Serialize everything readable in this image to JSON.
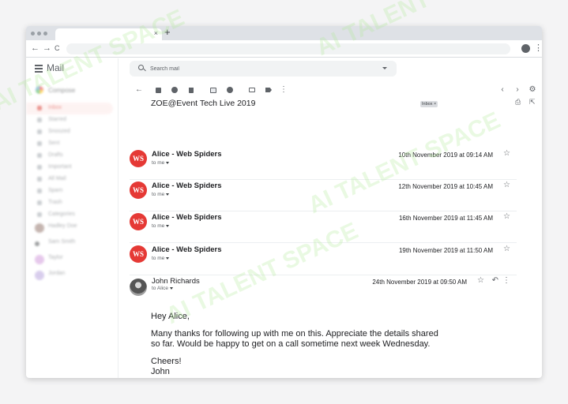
{
  "browser": {
    "tab_close": "×",
    "new_tab": "+",
    "back": "←",
    "forward": "→",
    "reload": "C",
    "menu": "⋮"
  },
  "app": {
    "name": "Mail"
  },
  "sidebar": {
    "compose_label": "Compose",
    "items": [
      "Inbox",
      "Starred",
      "Snoozed",
      "Sent",
      "Drafts",
      "Important",
      "All Mail",
      "Spam",
      "Trash",
      "Categories"
    ],
    "contacts": [
      {
        "name": "Hadley Doe",
        "color": "#8d6e63"
      },
      {
        "name": "Sam Smith",
        "color": "#3c4043"
      },
      {
        "name": "Taylor",
        "color": "#ce93d8"
      },
      {
        "name": "Jordan",
        "color": "#b39ddb"
      }
    ]
  },
  "search": {
    "placeholder": "Search mail"
  },
  "toolbar": {
    "back": "←",
    "more": "⋮",
    "prev": "‹",
    "next": "›",
    "settings": "⚙"
  },
  "thread": {
    "subject": "ZOE@Event Tech Live 2019",
    "label": "Inbox ×",
    "print_icon": "⎙",
    "open_icon": "⇱"
  },
  "messages": [
    {
      "avatar": "WS",
      "sender": "Alice - Web Spiders",
      "to": "to me",
      "date": "10th November 2019 at 09:14 AM"
    },
    {
      "avatar": "WS",
      "sender": "Alice - Web Spiders",
      "to": "to me",
      "date": "12th November 2019 at 10:45 AM"
    },
    {
      "avatar": "WS",
      "sender": "Alice - Web Spiders",
      "to": "to me",
      "date": "16th November 2019 at 11:45 AM"
    },
    {
      "avatar": "WS",
      "sender": "Alice - Web Spiders",
      "to": "to me",
      "date": "19th November 2019 at 11:50 AM"
    }
  ],
  "open_message": {
    "sender": "John Richards",
    "to": "to Alice",
    "date": "24th November 2019 at 09:50 AM",
    "star": "☆",
    "reply": "↶",
    "more": "⋮",
    "greeting": "Hey Alice,",
    "line1": "Many thanks for following up with me on this. Appreciate the details shared",
    "line2": "so far. Would be happy to get on a call sometime next week Wednesday.",
    "signoff": "Cheers!",
    "signature": "John"
  },
  "star_glyph": "☆",
  "watermark": "AI TALENT SPACE",
  "colors": {
    "ws_avatar": "#e53935",
    "active_nav": "#d93025"
  }
}
